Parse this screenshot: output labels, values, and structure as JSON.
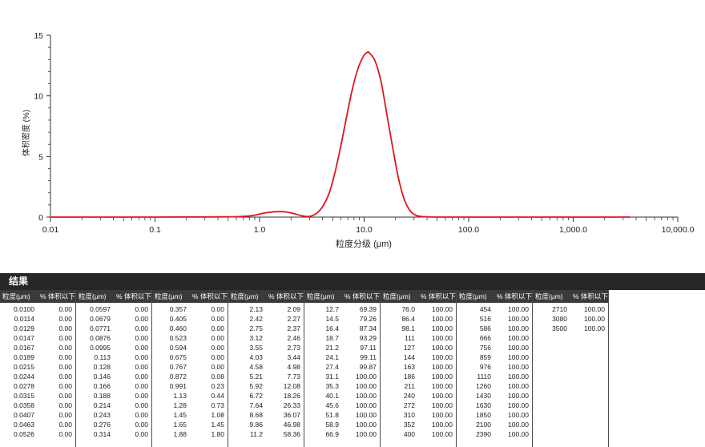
{
  "chart_data": {
    "type": "line",
    "xlabel": "粒度分级 (μm)",
    "ylabel": "体积密度 (%)",
    "x_scale": "log",
    "xlim": [
      0.01,
      10000
    ],
    "ylim": [
      0,
      15
    ],
    "x_tick_labels": [
      "0.01",
      "0.1",
      "1.0",
      "10.0",
      "100.0",
      "1,000.0",
      "10,000.0"
    ],
    "y_tick_labels": [
      "0",
      "5",
      "10",
      "15"
    ],
    "line_color": "#e0151b",
    "series": [
      {
        "x": [
          0.01,
          0.1,
          0.5,
          0.8,
          1.0,
          1.2,
          1.5,
          1.8,
          2.1,
          2.5,
          2.8,
          3.1,
          3.5,
          4.0,
          4.6,
          5.2,
          5.9,
          6.7,
          7.6,
          8.7,
          9.9,
          10.8,
          11.2,
          12.7,
          14.5,
          16.4,
          18.7,
          21.2,
          24.1,
          27.4,
          31.1,
          35.3,
          40.1,
          50.0,
          100,
          1000,
          3500
        ],
        "y": [
          0,
          0,
          0.02,
          0.1,
          0.25,
          0.38,
          0.45,
          0.42,
          0.3,
          0.12,
          0.05,
          0.08,
          0.3,
          0.85,
          1.9,
          3.5,
          5.6,
          8.0,
          10.3,
          12.2,
          13.3,
          13.6,
          13.55,
          12.9,
          11.2,
          8.6,
          5.8,
          3.3,
          1.5,
          0.55,
          0.15,
          0.05,
          0.02,
          0,
          0,
          0,
          0
        ]
      }
    ]
  },
  "results": {
    "title": "结果",
    "size_header": "粒度(μm)",
    "pct_header": "% 体积以下",
    "columns": [
      {
        "size": [
          "0.0100",
          "0.0114",
          "0.0129",
          "0.0147",
          "0.0167",
          "0.0189",
          "0.0215",
          "0.0244",
          "0.0278",
          "0.0315",
          "0.0358",
          "0.0407",
          "0.0463",
          "0.0526"
        ],
        "pct": [
          "0.00",
          "0.00",
          "0.00",
          "0.00",
          "0.00",
          "0.00",
          "0.00",
          "0.00",
          "0.00",
          "0.00",
          "0.00",
          "0.00",
          "0.00",
          "0.00"
        ]
      },
      {
        "size": [
          "0.0597",
          "0.0679",
          "0.0771",
          "0.0876",
          "0.0995",
          "0.113",
          "0.128",
          "0.146",
          "0.166",
          "0.188",
          "0.214",
          "0.243",
          "0.276",
          "0.314"
        ],
        "pct": [
          "0.00",
          "0.00",
          "0.00",
          "0.00",
          "0.00",
          "0.00",
          "0.00",
          "0.00",
          "0.00",
          "0.00",
          "0.00",
          "0.00",
          "0.00",
          "0.00"
        ]
      },
      {
        "size": [
          "0.357",
          "0.405",
          "0.460",
          "0.523",
          "0.594",
          "0.675",
          "0.767",
          "0.872",
          "0.991",
          "1.13",
          "1.28",
          "1.45",
          "1.65",
          "1.88"
        ],
        "pct": [
          "0.00",
          "0.00",
          "0.00",
          "0.00",
          "0.00",
          "0.00",
          "0.00",
          "0.08",
          "0.23",
          "0.44",
          "0.73",
          "1.08",
          "1.45",
          "1.80"
        ]
      },
      {
        "size": [
          "2.13",
          "2.42",
          "2.75",
          "3.12",
          "3.55",
          "4.03",
          "4.58",
          "5.21",
          "5.92",
          "6.72",
          "7.64",
          "8.68",
          "9.86",
          "11.2"
        ],
        "pct": [
          "2.09",
          "2.27",
          "2.37",
          "2.46",
          "2.73",
          "3.44",
          "4.98",
          "7.73",
          "12.08",
          "18.26",
          "26.33",
          "36.07",
          "46.98",
          "58.36"
        ]
      },
      {
        "size": [
          "12.7",
          "14.5",
          "16.4",
          "18.7",
          "21.2",
          "24.1",
          "27.4",
          "31.1",
          "35.3",
          "40.1",
          "45.6",
          "51.8",
          "58.9",
          "66.9"
        ],
        "pct": [
          "69.39",
          "79.26",
          "87.34",
          "93.29",
          "97.11",
          "99.11",
          "99.87",
          "100.00",
          "100.00",
          "100.00",
          "100.00",
          "100.00",
          "100.00",
          "100.00"
        ]
      },
      {
        "size": [
          "76.0",
          "86.4",
          "98.1",
          "111",
          "127",
          "144",
          "163",
          "186",
          "211",
          "240",
          "272",
          "310",
          "352",
          "400"
        ],
        "pct": [
          "100.00",
          "100.00",
          "100.00",
          "100.00",
          "100.00",
          "100.00",
          "100.00",
          "100.00",
          "100.00",
          "100.00",
          "100.00",
          "100.00",
          "100.00",
          "100.00"
        ]
      },
      {
        "size": [
          "454",
          "516",
          "586",
          "666",
          "756",
          "859",
          "976",
          "1110",
          "1260",
          "1430",
          "1630",
          "1850",
          "2100",
          "2390"
        ],
        "pct": [
          "100.00",
          "100.00",
          "100.00",
          "100.00",
          "100.00",
          "100.00",
          "100.00",
          "100.00",
          "100.00",
          "100.00",
          "100.00",
          "100.00",
          "100.00",
          "100.00"
        ]
      },
      {
        "size": [
          "2710",
          "3080",
          "3500"
        ],
        "pct": [
          "100.00",
          "100.00",
          "100.00"
        ]
      }
    ]
  }
}
